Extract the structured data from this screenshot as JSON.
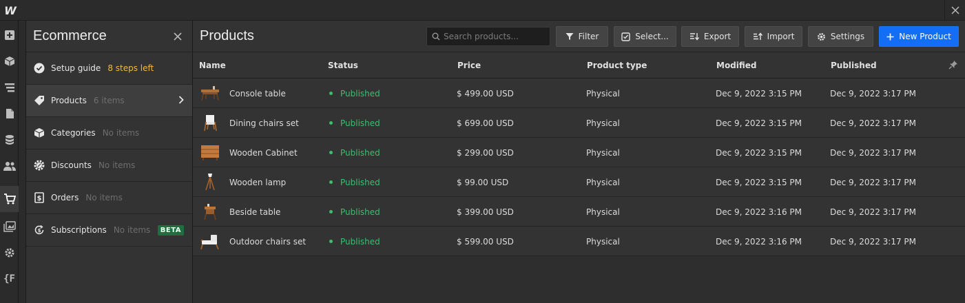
{
  "topbar": {
    "logo_label": "W"
  },
  "sidebar_icons": [
    "add-icon",
    "box-icon",
    "navigator-icon",
    "pages-icon",
    "cms-icon",
    "users-icon",
    "ecommerce-icon",
    "assets-icon",
    "settings-icon",
    "variables-icon"
  ],
  "panel": {
    "title": "Ecommerce",
    "items": [
      {
        "label": "Setup guide",
        "extra": "8 steps left",
        "icon": "check-circle-icon"
      },
      {
        "label": "Products",
        "extra": "6 items",
        "icon": "tag-icon"
      },
      {
        "label": "Categories",
        "extra": "No items",
        "icon": "cube-icon"
      },
      {
        "label": "Discounts",
        "extra": "No items",
        "icon": "discount-icon"
      },
      {
        "label": "Orders",
        "extra": "No items",
        "icon": "receipt-icon"
      },
      {
        "label": "Subscriptions",
        "extra": "No items",
        "icon": "subscription-icon",
        "badge": "BETA"
      }
    ]
  },
  "main": {
    "title": "Products",
    "search_placeholder": "Search products...",
    "buttons": {
      "filter": "Filter",
      "select": "Select...",
      "export": "Export",
      "import": "Import",
      "settings": "Settings",
      "new_product": "New Product"
    }
  },
  "table": {
    "columns": [
      "Name",
      "Status",
      "Price",
      "Product type",
      "Modified",
      "Published"
    ],
    "rows": [
      {
        "name": "Console table",
        "status": "Published",
        "price": "$ 499.00 USD",
        "type": "Physical",
        "modified": "Dec 9, 2022 3:15 PM",
        "published": "Dec 9, 2022 3:17 PM"
      },
      {
        "name": "Dining chairs set",
        "status": "Published",
        "price": "$ 699.00 USD",
        "type": "Physical",
        "modified": "Dec 9, 2022 3:15 PM",
        "published": "Dec 9, 2022 3:17 PM"
      },
      {
        "name": "Wooden Cabinet",
        "status": "Published",
        "price": "$ 299.00 USD",
        "type": "Physical",
        "modified": "Dec 9, 2022 3:15 PM",
        "published": "Dec 9, 2022 3:17 PM"
      },
      {
        "name": "Wooden lamp",
        "status": "Published",
        "price": "$ 99.00 USD",
        "type": "Physical",
        "modified": "Dec 9, 2022 3:15 PM",
        "published": "Dec 9, 2022 3:17 PM"
      },
      {
        "name": "Beside table",
        "status": "Published",
        "price": "$ 399.00 USD",
        "type": "Physical",
        "modified": "Dec 9, 2022 3:16 PM",
        "published": "Dec 9, 2022 3:17 PM"
      },
      {
        "name": "Outdoor chairs set",
        "status": "Published",
        "price": "$ 599.00 USD",
        "type": "Physical",
        "modified": "Dec 9, 2022 3:16 PM",
        "published": "Dec 9, 2022 3:17 PM"
      }
    ]
  },
  "colors": {
    "accent": "#146ef5",
    "published": "#3bbf6d",
    "warning": "#f5b93f",
    "beta": "#1f6e3f"
  }
}
